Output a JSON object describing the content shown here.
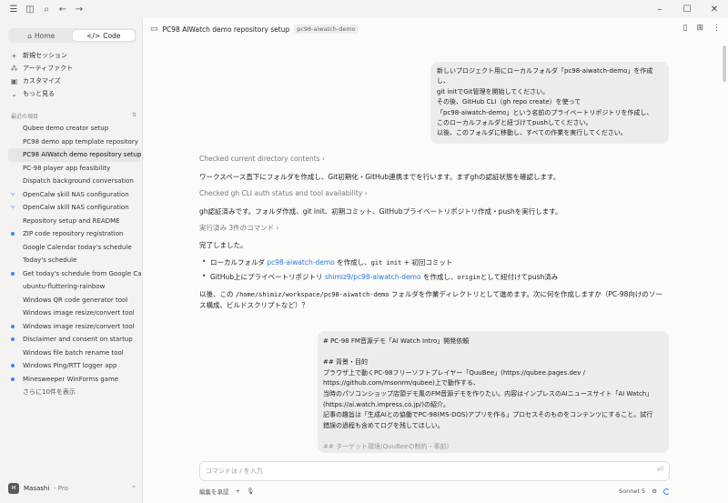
{
  "titlebar": {
    "icons": [
      "menu-icon",
      "sidebar-toggle-icon",
      "search-icon",
      "back-icon",
      "forward-icon"
    ],
    "window_controls": [
      "minimize-icon",
      "maximize-icon",
      "close-icon"
    ]
  },
  "sidebar": {
    "tabs": [
      {
        "label": "Home",
        "icon": "home-icon",
        "active": false
      },
      {
        "label": "Code",
        "icon": "code-icon",
        "active": true
      }
    ],
    "nav": [
      {
        "label": "新規セッション",
        "icon": "plus-icon"
      },
      {
        "label": "アーティファクト",
        "icon": "artifact-icon"
      },
      {
        "label": "カスタマイズ",
        "icon": "customize-icon"
      },
      {
        "label": "もっと見る",
        "icon": "chevron-down-icon"
      }
    ],
    "recent_heading": "最近の項目",
    "recent": [
      {
        "label": "Qubee demo creator setup",
        "lead": ""
      },
      {
        "label": "PC98 demo app template repository",
        "lead": ""
      },
      {
        "label": "PC98 AIWatch demo repository setup",
        "lead": "",
        "active": true
      },
      {
        "label": "PC-98 player app feasibility",
        "lead": ""
      },
      {
        "label": "Dispatch background conversation",
        "lead": ""
      },
      {
        "label": "OpenCalw skill NAS configuration",
        "lead": "fork"
      },
      {
        "label": "OpenCalw skill NAS configuration",
        "lead": "fork"
      },
      {
        "label": "Repository setup and README",
        "lead": ""
      },
      {
        "label": "ZIP code repository registration",
        "lead": "dot"
      },
      {
        "label": "Google Calendar today's schedule",
        "lead": ""
      },
      {
        "label": "Today's schedule",
        "lead": ""
      },
      {
        "label": "Get today's schedule from Google Ca",
        "lead": "dot"
      },
      {
        "label": "ubuntu-fluttering-rainbow",
        "lead": ""
      },
      {
        "label": "Windows QR code generator tool",
        "lead": ""
      },
      {
        "label": "Windows image resize/convert tool",
        "lead": ""
      },
      {
        "label": "Windows image resize/convert tool",
        "lead": "dot"
      },
      {
        "label": "Disclaimer and consent on startup",
        "lead": "dot"
      },
      {
        "label": "Windows file batch rename tool",
        "lead": ""
      },
      {
        "label": "Windows Ping/RTT logger app",
        "lead": "dot"
      },
      {
        "label": "Minesweeper WinForms game",
        "lead": "dot"
      }
    ],
    "show_more": "さらに10件を表示",
    "user": {
      "initials": "M",
      "name": "Masashi",
      "plan": "· Pro"
    }
  },
  "main": {
    "title": "PC98 AIWatch demo repository setup",
    "chip": "pc98-aiwatch-demo",
    "head_icons": [
      "panel-icon",
      "add-icon",
      "more-icon"
    ],
    "user_message": [
      "新しいプロジェクト用にローカルフォルダ「pc98-aiwatch-demo」を作成し、",
      "git initでGit管理を開始してください。",
      "その後、GitHub CLI（gh repo create）を使って",
      "「pc98-aiwatch-demo」という名前のプライベートリポジトリを作成し、",
      "このローカルフォルダと紐づけてpushしてください。",
      "以後、このフォルダに移動し、すべての作業を実行してください。"
    ],
    "step1": "Checked current directory contents",
    "text1": "ワークスペース直下にフォルダを作成し、Git初期化・GitHub連携までを行います。まずghの認証状態を確認します。",
    "step2": "Checked gh CLI auth status and tool availability",
    "text2": "gh認証済みです。フォルダ作成、git init、初期コミット、GitHubプライベートリポジトリ作成・pushを実行します。",
    "step3": "実行済み 3件のコマンド",
    "done": "完了しました。",
    "bullet1": {
      "pre": "ローカルフォルダ ",
      "link": "pc98-aiwatch-demo",
      "mid": " を作成し、",
      "code": "git init",
      "post": " + 初回コミット"
    },
    "bullet2": {
      "pre": "GitHub上にプライベートリポジトリ ",
      "link": "shimiz9/pc98-aiwatch-demo",
      "mid": " を作成し、",
      "code": "origin",
      "post": "として紐付けてpush済み"
    },
    "after": {
      "pre": "以後、この ",
      "code": "/home/shimiz/workspace/pc98-aiwatch-demo",
      "post": " フォルダを作業ディレクトリとして進めます。次に何を作成しますか（PC-98向けのソー",
      "line2": "ス構成、ビルドスクリプトなど）？"
    },
    "request": [
      "# PC-98 FM音源デモ「AI Watch Intro」開発依頼",
      "",
      "## 背景・目的",
      "ブラウザ上で動くPC-98フリーソフトプレイヤー「QuuBee」(https://qubee.pages.dev /",
      "https://github.com/msonrm/qubee)上で動作する、",
      "当時のパソコンショップ店頭デモ風のFM音源デモを作りたい。内容はインプレスのAIニュースサイト「AI Watch」",
      "(https://ai.watch.impress.co.jp/)の紹介。",
      "記事の趣旨は「生成AIとの協働でPC-98(MS-DOS)アプリを作る」プロセスそのものをコンテンツにすること。試行",
      "錯誤の過程も含めてログを残してほしい。",
      "",
      "## ターゲット環境(QuuBeeの制約・事前)"
    ],
    "input_placeholder": "コマンドは / を入力",
    "bottom": {
      "approve": "編集を承認",
      "model": "Sonnet 5"
    }
  }
}
